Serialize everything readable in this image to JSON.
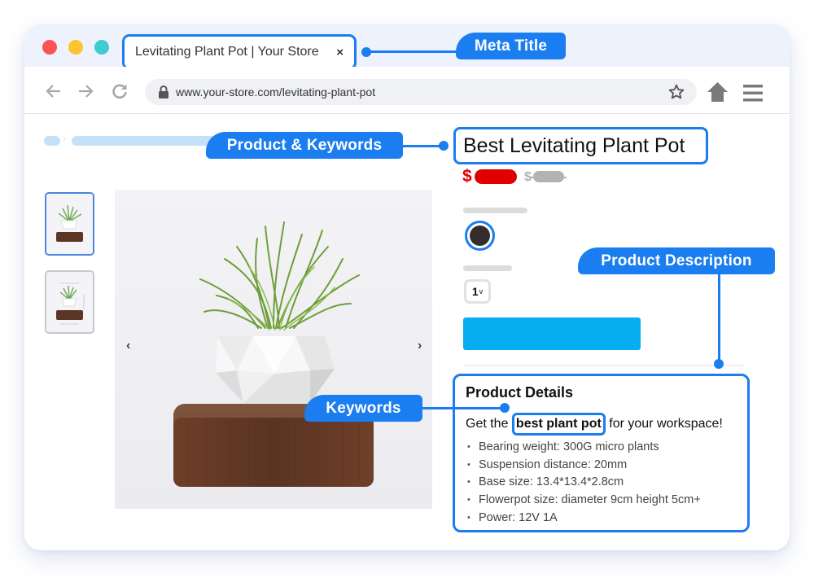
{
  "browser": {
    "tab_title": "Levitating Plant Pot | Your Store",
    "tab_close": "×",
    "url": "www.your-store.com/levitating-plant-pot",
    "icons": {
      "back": "arrow-left-icon",
      "forward": "arrow-right-icon",
      "reload": "reload-icon",
      "lock": "lock-icon",
      "bookmark": "star-icon",
      "home": "home-icon",
      "menu": "hamburger-menu-icon"
    },
    "window_controls": [
      "close",
      "minimize",
      "maximize"
    ]
  },
  "callouts": {
    "meta_title": "Meta Title",
    "product_keywords": "Product & Keywords",
    "product_description": "Product Description",
    "keywords": "Keywords"
  },
  "product": {
    "title": "Best Levitating Plant Pot",
    "price_symbol": "$",
    "compare_price_symbol": "$",
    "color_selected": "#352d2d",
    "quantity": "1",
    "quantity_caret": "v",
    "carousel_prev": "‹",
    "carousel_next": "›",
    "thumbnails": [
      "Product photo",
      "Product dimensions photo"
    ]
  },
  "details": {
    "heading": "Product Details",
    "lead_before": "Get the ",
    "lead_keyword": "best plant pot",
    "lead_after": " for your workspace!",
    "bullets": [
      "Bearing weight: 300G micro plants",
      "Suspension distance: 20mm",
      "Base size: 13.4*13.4*2.8cm",
      "Flowerpot size: diameter 9cm height 5cm+",
      "Power: 12V 1A"
    ]
  },
  "colors": {
    "accent": "#1a7df0",
    "sale_price": "#e00000",
    "compare_price": "#b3b3b3",
    "add_to_cart": "#07adf1",
    "breadcrumb": "#c5e1f7"
  }
}
